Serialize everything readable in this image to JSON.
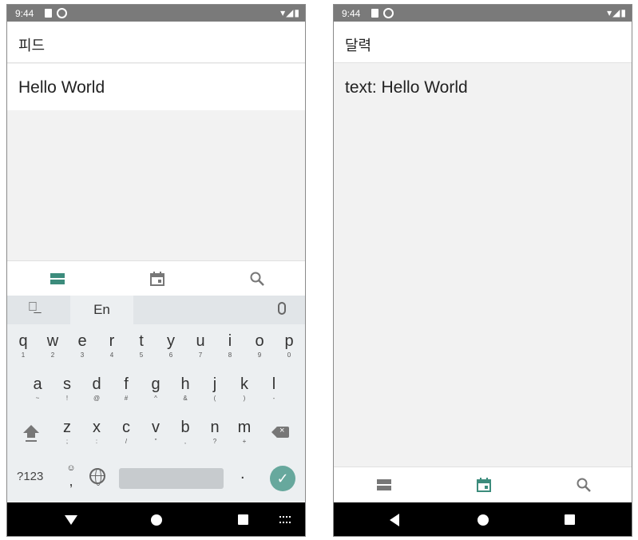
{
  "colors": {
    "accent": "#3c8c7c",
    "tab_inactive": "#777777",
    "status_bar": "#7a7a7a",
    "keyboard_bg": "#eceff1",
    "enter_key": "#67a89d"
  },
  "status_bar": {
    "time": "9:44"
  },
  "left_screen": {
    "title": "피드",
    "content": "Hello World",
    "tabs": [
      {
        "icon": "list-icon",
        "active": true
      },
      {
        "icon": "calendar-icon",
        "active": false
      },
      {
        "icon": "search-icon",
        "active": false
      }
    ],
    "keyboard": {
      "language": "En",
      "rows": [
        [
          {
            "key": "q",
            "sub": "1"
          },
          {
            "key": "w",
            "sub": "2"
          },
          {
            "key": "e",
            "sub": "3"
          },
          {
            "key": "r",
            "sub": "4"
          },
          {
            "key": "t",
            "sub": "5"
          },
          {
            "key": "y",
            "sub": "6"
          },
          {
            "key": "u",
            "sub": "7"
          },
          {
            "key": "i",
            "sub": "8"
          },
          {
            "key": "o",
            "sub": "9"
          },
          {
            "key": "p",
            "sub": "0"
          }
        ],
        [
          {
            "key": "a",
            "sub": "~"
          },
          {
            "key": "s",
            "sub": "!"
          },
          {
            "key": "d",
            "sub": "@"
          },
          {
            "key": "f",
            "sub": "#"
          },
          {
            "key": "g",
            "sub": "^"
          },
          {
            "key": "h",
            "sub": "&"
          },
          {
            "key": "j",
            "sub": "("
          },
          {
            "key": "k",
            "sub": ")"
          },
          {
            "key": "l",
            "sub": "-"
          }
        ],
        [
          {
            "key": "z",
            "sub": ";"
          },
          {
            "key": "x",
            "sub": ":"
          },
          {
            "key": "c",
            "sub": "/"
          },
          {
            "key": "v",
            "sub": "\""
          },
          {
            "key": "b",
            "sub": ","
          },
          {
            "key": "n",
            "sub": "?"
          },
          {
            "key": "m",
            "sub": "+"
          }
        ]
      ],
      "symbols_label": "?123",
      "comma_label": ",",
      "period_label": "."
    }
  },
  "right_screen": {
    "title": "달력",
    "content": "text: Hello World",
    "tabs": [
      {
        "icon": "list-icon",
        "active": false
      },
      {
        "icon": "calendar-icon",
        "active": true
      },
      {
        "icon": "search-icon",
        "active": false
      }
    ]
  }
}
